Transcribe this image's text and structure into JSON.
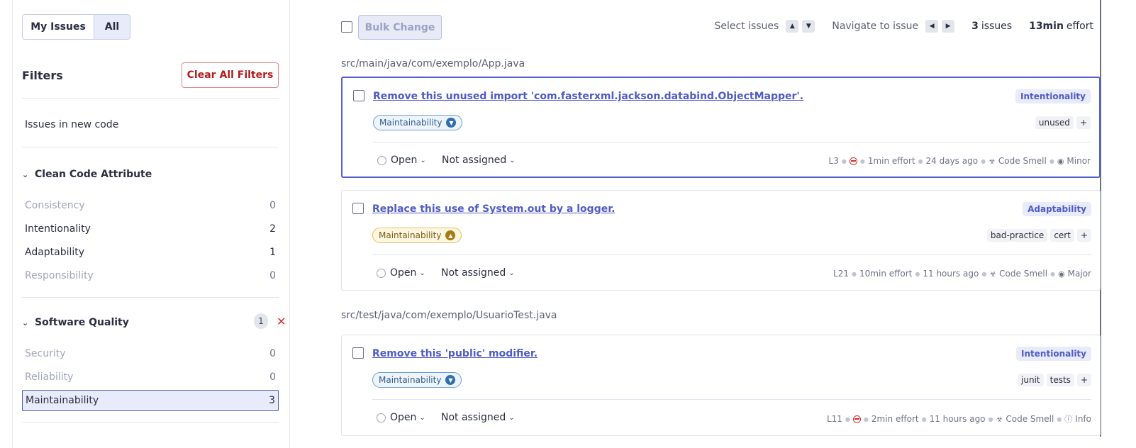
{
  "sidebar": {
    "toggle": {
      "my_issues": "My Issues",
      "all": "All"
    },
    "filters_title": "Filters",
    "clear_all": "Clear All Filters",
    "new_code": "Issues in new code",
    "clean_code": {
      "title": "Clean Code Attribute",
      "items": [
        {
          "label": "Consistency",
          "count": "0"
        },
        {
          "label": "Intentionality",
          "count": "2"
        },
        {
          "label": "Adaptability",
          "count": "1"
        },
        {
          "label": "Responsibility",
          "count": "0"
        }
      ]
    },
    "software_quality": {
      "title": "Software Quality",
      "badge": "1",
      "items": [
        {
          "label": "Security",
          "count": "0"
        },
        {
          "label": "Reliability",
          "count": "0"
        },
        {
          "label": "Maintainability",
          "count": "3"
        }
      ]
    }
  },
  "toolbar": {
    "bulk_change": "Bulk Change",
    "select_issues": "Select issues",
    "navigate": "Navigate to issue",
    "issues_count": "3",
    "issues_label": "issues",
    "effort_value": "13min",
    "effort_label": "effort"
  },
  "groups": [
    {
      "path": "src/main/java/com/exemplo/App.java",
      "issues": [
        {
          "title": "Remove this unused import 'com.fasterxml.jackson.databind.ObjectMapper'.",
          "attribute": "Intentionality",
          "quality": "Maintainability",
          "tags": [
            "unused",
            "+"
          ],
          "status": "Open",
          "assignee": "Not assigned",
          "line": "L3",
          "effort": "1min effort",
          "age": "24 days ago",
          "type": "Code Smell",
          "severity": "Minor"
        },
        {
          "title": "Replace this use of System.out by a logger.",
          "attribute": "Adaptability",
          "quality": "Maintainability",
          "tags": [
            "bad-practice",
            "cert",
            "+"
          ],
          "status": "Open",
          "assignee": "Not assigned",
          "line": "L21",
          "effort": "10min effort",
          "age": "11 hours ago",
          "type": "Code Smell",
          "severity": "Major"
        }
      ]
    },
    {
      "path": "src/test/java/com/exemplo/UsuarioTest.java",
      "issues": [
        {
          "title": "Remove this 'public' modifier.",
          "attribute": "Intentionality",
          "quality": "Maintainability",
          "tags": [
            "junit",
            "tests",
            "+"
          ],
          "status": "Open",
          "assignee": "Not assigned",
          "line": "L11",
          "effort": "2min effort",
          "age": "11 hours ago",
          "type": "Code Smell",
          "severity": "Info"
        }
      ]
    }
  ]
}
